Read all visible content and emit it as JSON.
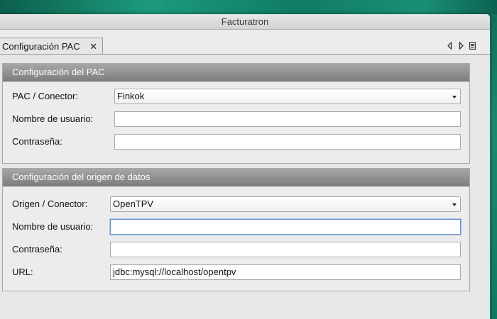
{
  "app": {
    "title": "Facturatron"
  },
  "tabs": [
    {
      "label": "Configuración PAC",
      "close_glyph": "✕"
    }
  ],
  "tab_controls": [
    "scroll-left-icon",
    "scroll-right-icon",
    "tab-list-icon"
  ],
  "pac": {
    "header": "Configuración del PAC",
    "connector_label": "PAC / Conector:",
    "connector_value": "Finkok",
    "username_label": "Nombre de usuario:",
    "username_value": "",
    "password_label": "Contraseña:",
    "password_value": ""
  },
  "datasource": {
    "header": "Configuración del origen de datos",
    "connector_label": "Origen / Conector:",
    "connector_value": "OpenTPV",
    "username_label": "Nombre de usuario:",
    "username_value": "",
    "password_label": "Contraseña:",
    "password_value": "",
    "url_label": "URL:",
    "url_value": "jdbc:mysql://localhost/opentpv"
  },
  "colors": {
    "panel_header": "#8f8f8f",
    "focus_ring": "#6f91c9",
    "window_bg": "#ececec"
  }
}
